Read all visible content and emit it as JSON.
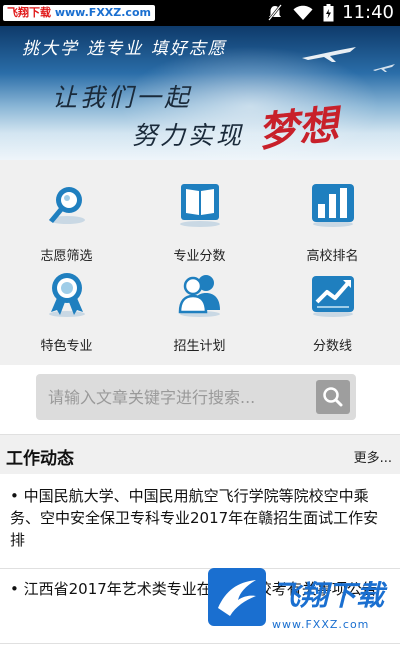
{
  "status_bar": {
    "watermark_left": "飞翔下载",
    "watermark_right": "www.FXXZ.com",
    "time": "11:40"
  },
  "banner": {
    "slogan_top": "挑大学 选专业 填好志愿",
    "line1": "让我们一起",
    "line2": "努力实现",
    "highlight": "梦想"
  },
  "grid": {
    "items": [
      {
        "label": "志愿筛选",
        "icon": "magnifier-icon"
      },
      {
        "label": "专业分数",
        "icon": "book-icon"
      },
      {
        "label": "高校排名",
        "icon": "bar-chart-icon"
      },
      {
        "label": "特色专业",
        "icon": "award-ribbon-icon"
      },
      {
        "label": "招生计划",
        "icon": "people-icon"
      },
      {
        "label": "分数线",
        "icon": "trend-chart-icon"
      }
    ]
  },
  "search": {
    "placeholder": "请输入文章关键字进行搜索..."
  },
  "section": {
    "title": "工作动态",
    "more": "更多..."
  },
  "news": [
    "• 中国民航大学、中国民用航空飞行学院等院校空中乘务、空中安全保卫专科专业2017年在赣招生面试工作安排",
    "• 江西省2017年艺术类专业在赣设点校考有关事项公告"
  ],
  "watermark_badge": {
    "text": "飞翔下载",
    "url": "www.FXXZ.com"
  },
  "colors": {
    "brand_blue": "#1a6fd0",
    "icon_blue": "#1f7fbf",
    "grid_bg": "#f0f0f0"
  }
}
